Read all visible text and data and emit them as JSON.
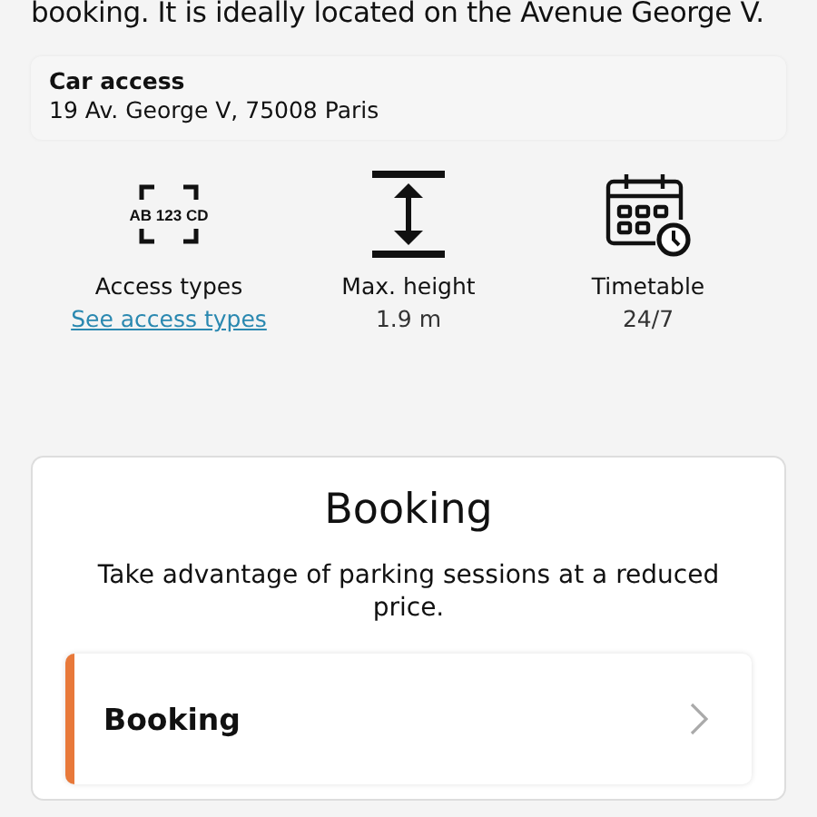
{
  "intro": "booking. It is ideally located on the Avenue George V.",
  "access_card": {
    "title": "Car access",
    "address": "19 Av. George V, 75008 Paris"
  },
  "features": [
    {
      "kind": "plate",
      "icon_text": "AB 123 CD",
      "label": "Access types",
      "link": "See access types"
    },
    {
      "kind": "height",
      "label": "Max. height",
      "value": "1.9 m"
    },
    {
      "kind": "calendar",
      "label": "Timetable",
      "value": "24/7"
    }
  ],
  "booking": {
    "title": "Booking",
    "description": "Take advantage of parking sessions at a reduced price.",
    "items": [
      {
        "label": "Booking",
        "color": "#e8793a"
      }
    ]
  }
}
